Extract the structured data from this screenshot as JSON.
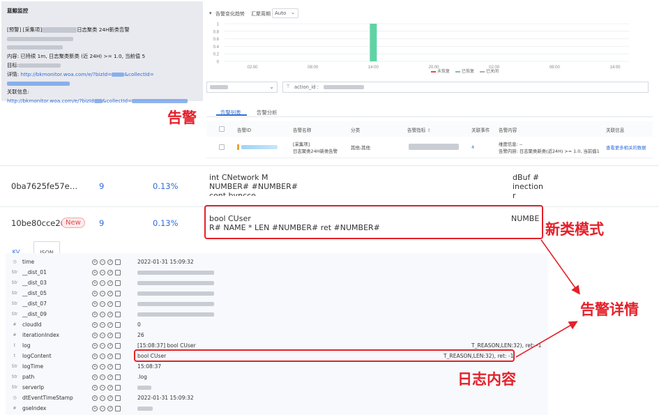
{
  "alert_card": {
    "title": "蓝鲸监控",
    "line1_prefix": "[预警] [采集项]",
    "line1_suffix": "日志聚类 24H新类告警",
    "line4": "内容: 已持续 1m, 日志聚类新类 (近 24H) >= 1.0, 当前值 5",
    "target_label": "目标:",
    "detail_label": "详情:",
    "detail_link": "http://bkmonitor.woa.com/e/?bizId=",
    "detail_link2": "&collectId=",
    "related_label": "关联信息:",
    "related_link": "http://bkmonitor.woa.com/e/?bizId",
    "related_link2": "&collectId="
  },
  "chart_toolbar": {
    "title": "告警变化趋势",
    "period_label": "汇聚周期",
    "period_value": "Auto"
  },
  "chart_data": {
    "type": "bar",
    "x_ticks": [
      "02:00",
      "08:00",
      "14:00",
      "20:00",
      "02:00",
      "08:00",
      "14:00"
    ],
    "y_ticks": [
      "0",
      "0.2",
      "0.4",
      "0.6",
      "0.8",
      "1"
    ],
    "ylim": [
      0,
      1
    ],
    "bars": [
      {
        "x": "14:00",
        "value": 1
      }
    ],
    "bar_color": "#5fd3a5",
    "legend": [
      {
        "name": "未恢复",
        "color": "#e5484d"
      },
      {
        "name": "已恢复",
        "color": "#7ec48f"
      },
      {
        "name": "已关闭",
        "color": "#a9adb6"
      }
    ]
  },
  "filter": {
    "query_prefix": "action_id : "
  },
  "alert_tabs": [
    {
      "label": "告警列表",
      "active": true
    },
    {
      "label": "告警分析",
      "active": false
    }
  ],
  "alert_table": {
    "headers": [
      "告警ID",
      "告警名称",
      "分类",
      "告警指标",
      "关联事件",
      "告警内容",
      "关联信息"
    ],
    "sort_marker": "⇕",
    "row": {
      "name_line1": "[采集项]",
      "name_line2": "日志聚类24H新类告警",
      "category": "其他-其他",
      "events": "4",
      "content_line1": "维度信息: --",
      "content_line2": "告警内容: 日志聚类新类(近24H) >= 1.0, 当前值1",
      "related": "查看更多相关的数据"
    }
  },
  "annotations": {
    "alert": "告警",
    "new_pattern": "新类模式",
    "alert_detail": "告警详情",
    "log_content": "日志内容"
  },
  "pattern_rows": [
    {
      "id": "0ba7625fe57e…",
      "count": "9",
      "percent": "0.13%",
      "text_line1": "int CNetwork M",
      "text_line2": "NUMBER# #NUMBER#",
      "text_line3": "cont byncco",
      "right_line1": "dBuf #",
      "right_line2": "inection r",
      "is_new": false
    },
    {
      "id": "10be80cce26…",
      "new_badge": "New",
      "count": "9",
      "percent": "0.13%",
      "text_line1": "bool CUser",
      "text_line2": "R# NAME * LEN #NUMBER# ret #NUMBER#",
      "right_line1": "NUMBE",
      "is_new": true
    }
  ],
  "kv_tabs": [
    {
      "label": "KV",
      "active": true
    },
    {
      "label": "JSON",
      "active": false
    }
  ],
  "kv_rows": [
    {
      "type": "◷",
      "key": "time",
      "value": "2022-01-31 15:09:32"
    },
    {
      "type": "Str",
      "key": "__dist_01",
      "value": ""
    },
    {
      "type": "Str",
      "key": "__dist_03",
      "value": ""
    },
    {
      "type": "Str",
      "key": "__dist_05",
      "value": ""
    },
    {
      "type": "Str",
      "key": "__dist_07",
      "value": ""
    },
    {
      "type": "Str",
      "key": "__dist_09",
      "value": ""
    },
    {
      "type": "#",
      "key": "cloudId",
      "value": "0"
    },
    {
      "type": "#",
      "key": "iterationIndex",
      "value": "26"
    },
    {
      "type": "t",
      "key": "log",
      "value": "[15:08:37] bool CUser",
      "value_right": "T_REASON,LEN:32), ret: -1"
    },
    {
      "type": "t",
      "key": "logContent",
      "value": "bool CUser",
      "value_right": "T_REASON,LEN:32), ret: -1"
    },
    {
      "type": "Str",
      "key": "logTime",
      "value": "15:08:37"
    },
    {
      "type": "Str",
      "key": "path",
      "value": ".log"
    },
    {
      "type": "Str",
      "key": "serverIp",
      "value": ""
    },
    {
      "type": "◷",
      "key": "dtEventTimeStamp",
      "value": "2022-01-31 15:09:32"
    },
    {
      "type": "#",
      "key": "gseIndex",
      "value": ""
    }
  ]
}
